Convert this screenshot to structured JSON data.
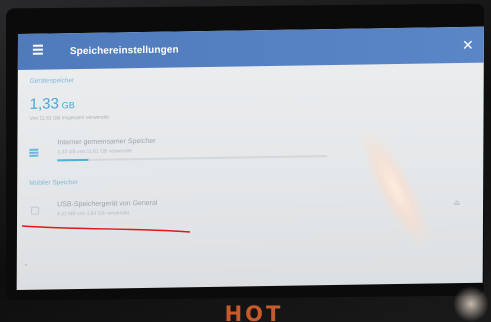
{
  "appbar": {
    "title": "Speichereinstellungen",
    "menu_icon": "menu-icon",
    "close_icon": "close-icon"
  },
  "device_storage": {
    "header": "Gerätespeicher",
    "used_value": "1,33",
    "used_unit": "GB",
    "subtitle": "Von 11,61 GB insgesamt verwendet",
    "item": {
      "icon": "storage-icon",
      "title": "Interner gemeinsamer Speicher",
      "subtitle": "1,33 GB von 11,61 GB verwendet",
      "progress_fraction": 0.115
    }
  },
  "portable_storage": {
    "header": "Mobiler Speicher",
    "item": {
      "icon": "usb-icon",
      "title": "USB-Speichergerät von General",
      "subtitle": "4,02 MB von 3,84 GB verwendet",
      "action_icon": "eject-icon"
    }
  },
  "colors": {
    "appbar": "#5a86c7",
    "accent": "#46a6d2",
    "annotation": "#e01818",
    "logo": "#c65a2b"
  },
  "logo_text": "HOT"
}
